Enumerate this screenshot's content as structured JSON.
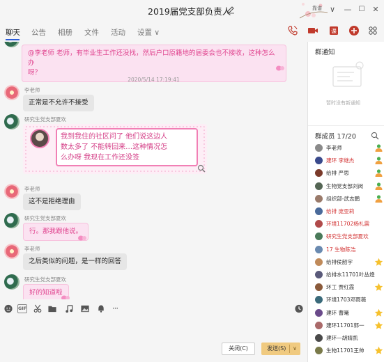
{
  "window": {
    "title": "2019届党支部负责人",
    "controls": {
      "badge_text": "靠谱",
      "min": "—",
      "max": "☐",
      "close": "✕",
      "dropdown": "∨"
    }
  },
  "tabs": [
    "聊天",
    "公告",
    "相册",
    "文件",
    "活动",
    "设置 ∨"
  ],
  "messages": [
    {
      "type": "bubble_pink",
      "lines": [
        "@李老师 老师，有毕业生工作还没找，然后户口原籍地的居委会也不接收，这种怎么办",
        "呀？"
      ]
    },
    {
      "type": "timestamp",
      "text": "2020/5/14 17:19:41"
    },
    {
      "type": "bubble",
      "sender": "李老师",
      "text": "正常是不允许不接受"
    },
    {
      "type": "bubble_ring",
      "sender": "研究生党支部夏欢",
      "lines": [
        "我到我住的社区问了 他们说这边人",
        "数太多了 不能转回来…这种情况怎",
        "么办呀 我现在工作还没签"
      ]
    },
    {
      "type": "bubble",
      "sender": "李老师",
      "text": "这不是拒绝理由"
    },
    {
      "type": "bubble_pink",
      "sender": "研究生党支部夏欢",
      "text": "行。那我跟他说。"
    },
    {
      "type": "bubble",
      "sender": "李老师",
      "text": "之后类似的问题，是一样的回答"
    },
    {
      "type": "bubble_pink",
      "sender": "研究生党支部夏欢",
      "text": "好的知道啦"
    }
  ],
  "toolbar": {
    "gif": "GIF",
    "more": "···"
  },
  "input": {
    "close_label": "关闭(C)",
    "send_label": "发送(S)"
  },
  "right_panel": {
    "notice_title": "群通知",
    "notice_empty": "暂时没有新通知",
    "members_title": "群成员 17/20",
    "members": [
      {
        "name": "李老师",
        "red": false,
        "badge": "admin"
      },
      {
        "name": "建环 李继杰",
        "red": true,
        "badge": "admin"
      },
      {
        "name": "给排 严思",
        "red": false,
        "badge": "admin"
      },
      {
        "name": "生物党支部刘闵",
        "red": false,
        "badge": "admin"
      },
      {
        "name": "组织部-武志鹏",
        "red": false,
        "badge": "admin"
      },
      {
        "name": "给排 庞亚莉",
        "red": true,
        "badge": "none"
      },
      {
        "name": "环境11702杨礼震",
        "red": true,
        "badge": "none"
      },
      {
        "name": "研究生党支部夏欢",
        "red": true,
        "badge": "none"
      },
      {
        "name": "17 生物陈浩",
        "red": true,
        "badge": "none"
      },
      {
        "name": "给排侯韶宇",
        "red": false,
        "badge": "star"
      },
      {
        "name": "给排水11701叶丛煌",
        "red": false,
        "badge": "none"
      },
      {
        "name": "环工 贾红霞",
        "red": false,
        "badge": "star"
      },
      {
        "name": "环境1703邓雨薇",
        "red": false,
        "badge": "none"
      },
      {
        "name": "建环 曹曦",
        "red": false,
        "badge": "star"
      },
      {
        "name": "建环11701郭一",
        "red": false,
        "badge": "star"
      },
      {
        "name": "建环—胡婧凯",
        "red": false,
        "badge": "none"
      },
      {
        "name": "生物11701王帅",
        "red": false,
        "badge": "star"
      }
    ]
  },
  "colors": {
    "accent": "#2b5bd7",
    "pink_text": "#e0448f",
    "send": "#f0ca80",
    "red_name": "#d23232"
  }
}
